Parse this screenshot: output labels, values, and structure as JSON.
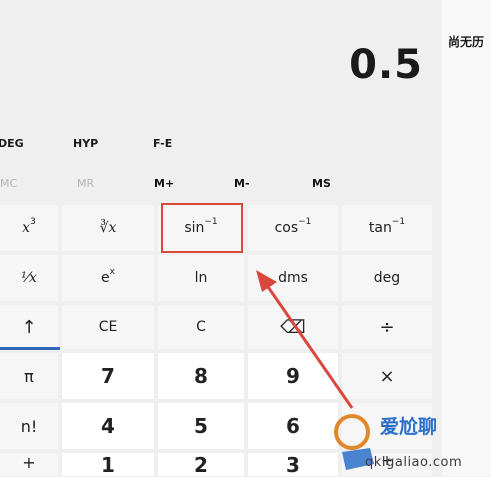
{
  "history": {
    "label": "尚无历"
  },
  "display": {
    "value": "0.5"
  },
  "modes": [
    "DEG",
    "HYP",
    "F-E"
  ],
  "memory": [
    "MC",
    "MR",
    "M+",
    "M-",
    "MS"
  ],
  "keys": {
    "row1": [
      "x",
      "∛x",
      "sin",
      "cos",
      "tan"
    ],
    "row1_sup": [
      "3",
      "",
      "−1",
      "−1",
      "−1"
    ],
    "row2": [
      "¹⁄x",
      "e",
      "ln",
      "dms",
      "deg"
    ],
    "row2_sup": [
      "",
      "x",
      "",
      "",
      ""
    ],
    "row3": [
      "↑",
      "CE",
      "C",
      "⌫",
      "÷"
    ],
    "row4": [
      "π",
      "7",
      "8",
      "9",
      "×"
    ],
    "row5": [
      "n!",
      "4",
      "5",
      "6",
      "−"
    ],
    "row6": [
      "+",
      "1",
      "2",
      "3",
      "+"
    ]
  },
  "colors": {
    "accent": "#2f68b8",
    "highlight": "#d9473d",
    "arrow": "#d9473d"
  },
  "watermark": {
    "text": "爱尬聊",
    "sub": "qkIgaliao.com"
  }
}
